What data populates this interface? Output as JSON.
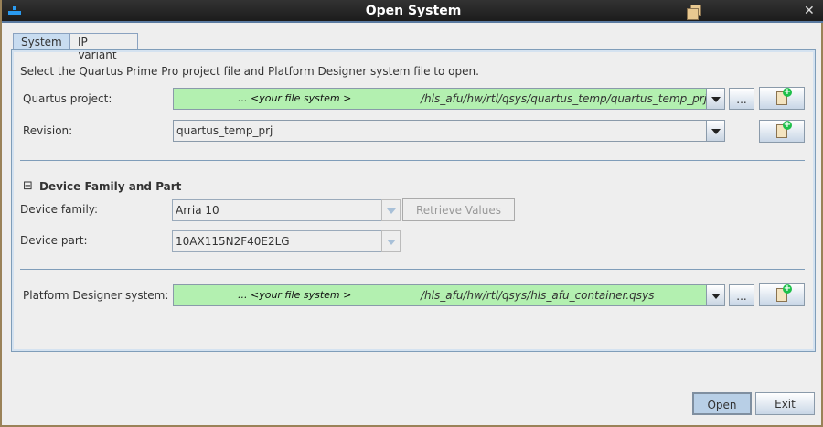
{
  "window": {
    "title": "Open System"
  },
  "tabs": [
    {
      "label": "System",
      "active": true
    },
    {
      "label": "IP Variant",
      "active": false
    }
  ],
  "instruction": "Select the Quartus Prime Pro project file and Platform Designer system file to open.",
  "quartus_project": {
    "label": "Quartus project:",
    "placeholder": "... <your file system >",
    "path": "/hls_afu/hw/rtl/qsys/quartus_temp/quartus_temp_prj",
    "browse": "..."
  },
  "revision": {
    "label": "Revision:",
    "value": "quartus_temp_prj"
  },
  "device_section": {
    "title": "Device Family and Part",
    "collapse_icon": "⊟",
    "family_label": "Device family:",
    "family_value": "Arria 10",
    "retrieve": "Retrieve Values",
    "part_label": "Device part:",
    "part_value": "10AX115N2F40E2LG"
  },
  "platform_designer": {
    "label": "Platform Designer system:",
    "placeholder": "... <your file system >",
    "path": "/hls_afu/hw/rtl/qsys/hls_afu_container.qsys",
    "browse": "..."
  },
  "footer": {
    "open": "Open",
    "exit": "Exit"
  }
}
